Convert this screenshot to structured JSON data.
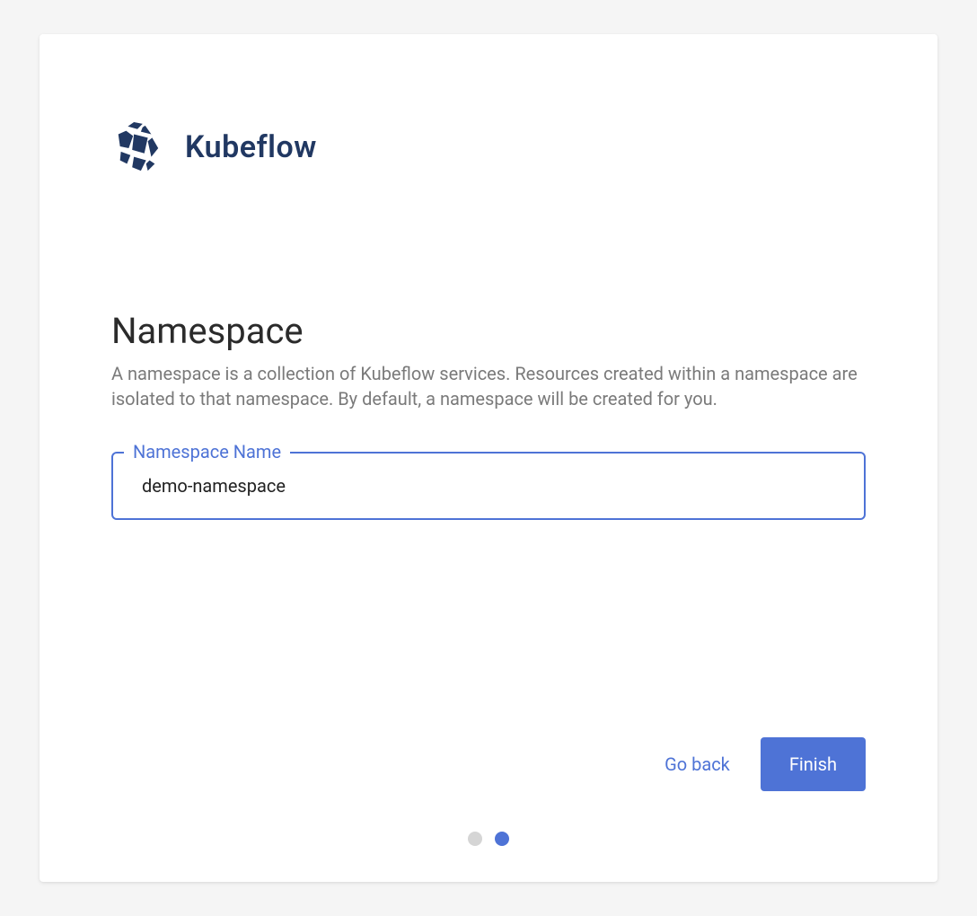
{
  "brand": {
    "name": "Kubeflow"
  },
  "heading": "Namespace",
  "description": "A namespace is a collection of Kubeflow services. Resources created within a namespace are isolated to that namespace. By default, a namespace will be created for you.",
  "input": {
    "label": "Namespace Name",
    "value": "demo-namespace"
  },
  "buttons": {
    "back": "Go back",
    "finish": "Finish"
  },
  "pager": {
    "total": 2,
    "active": 2
  },
  "colors": {
    "accent": "#4e73d6",
    "brand_dark": "#213862"
  }
}
